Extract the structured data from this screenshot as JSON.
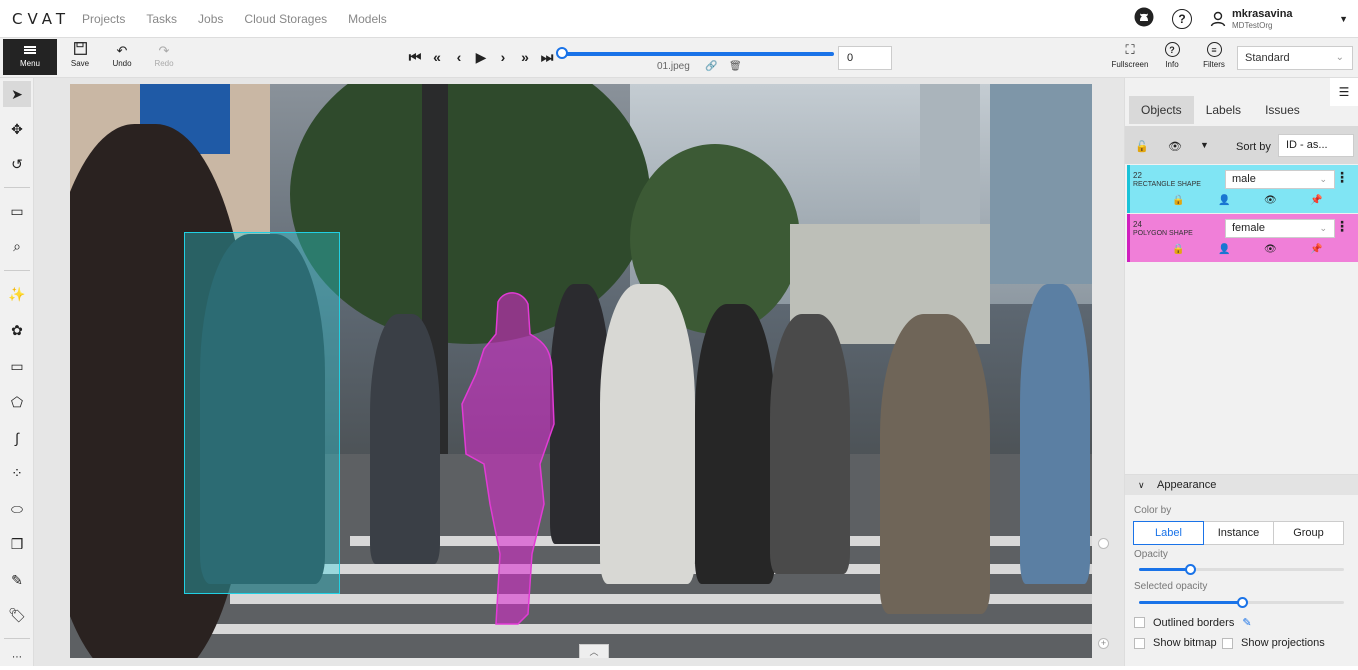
{
  "app": {
    "logo": "CVAT"
  },
  "nav": {
    "items": [
      "Projects",
      "Tasks",
      "Jobs",
      "Cloud Storages",
      "Models"
    ]
  },
  "user": {
    "name": "mkrasavina",
    "org": "MDTestOrg"
  },
  "toolbar": {
    "menu": "Menu",
    "save": "Save",
    "undo": "Undo",
    "redo": "Redo",
    "frame": "0",
    "filename": "01.jpeg",
    "fullscreen": "Fullscreen",
    "info": "Info",
    "filters": "Filters",
    "mode": "Standard"
  },
  "player": {
    "progress": 0.0
  },
  "sidebar": {
    "tabs": [
      "Objects",
      "Labels",
      "Issues"
    ],
    "sort_label": "Sort by",
    "sort_value": "ID - as...",
    "objects": [
      {
        "id": "22",
        "type": "RECTANGLE SHAPE",
        "label": "male",
        "color": "#80e5f4"
      },
      {
        "id": "24",
        "type": "POLYGON SHAPE",
        "label": "female",
        "color": "#f07fd8"
      }
    ],
    "appearance": {
      "title": "Appearance",
      "color_by_label": "Color by",
      "color_by_options": [
        "Label",
        "Instance",
        "Group"
      ],
      "color_by_selected": "Label",
      "opacity_label": "Opacity",
      "opacity_value": 0.25,
      "selected_opacity_label": "Selected opacity",
      "selected_opacity_value": 0.5,
      "outlined_borders": "Outlined borders",
      "show_bitmap": "Show bitmap",
      "show_projections": "Show projections"
    }
  },
  "colors": {
    "accent": "#1a73e8",
    "rectangle": "#21d0e3",
    "polygon": "#e23bd5"
  }
}
